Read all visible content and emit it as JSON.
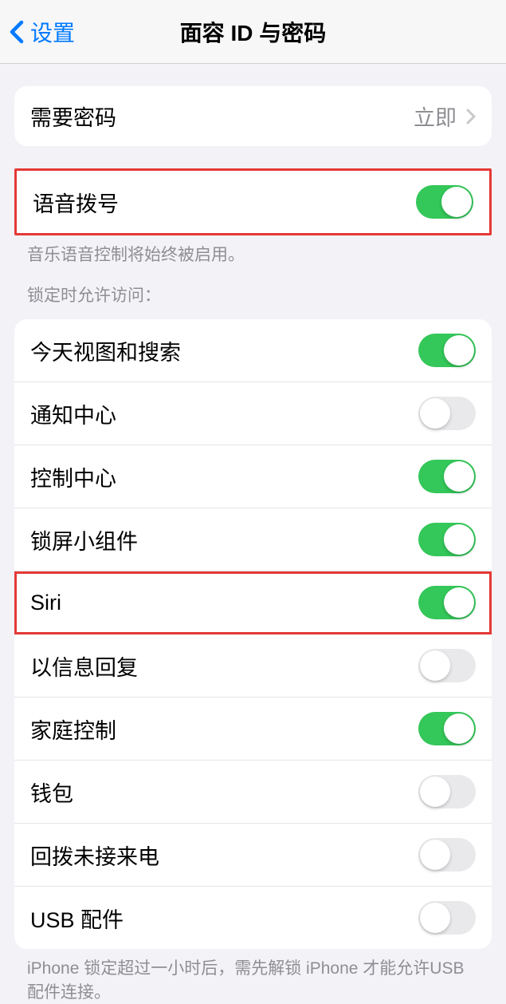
{
  "header": {
    "back_label": "设置",
    "title": "面容 ID 与密码"
  },
  "require_passcode": {
    "label": "需要密码",
    "value": "立即"
  },
  "voice_dial": {
    "label": "语音拨号",
    "enabled": true,
    "footer": "音乐语音控制将始终被启用。"
  },
  "lock_access": {
    "header": "锁定时允许访问：",
    "items": [
      {
        "label": "今天视图和搜索",
        "enabled": true,
        "highlighted": false
      },
      {
        "label": "通知中心",
        "enabled": false,
        "highlighted": false
      },
      {
        "label": "控制中心",
        "enabled": true,
        "highlighted": false
      },
      {
        "label": "锁屏小组件",
        "enabled": true,
        "highlighted": false
      },
      {
        "label": "Siri",
        "enabled": true,
        "highlighted": true
      },
      {
        "label": "以信息回复",
        "enabled": false,
        "highlighted": false
      },
      {
        "label": "家庭控制",
        "enabled": true,
        "highlighted": false
      },
      {
        "label": "钱包",
        "enabled": false,
        "highlighted": false
      },
      {
        "label": "回拨未接来电",
        "enabled": false,
        "highlighted": false
      },
      {
        "label": "USB 配件",
        "enabled": false,
        "highlighted": false
      }
    ],
    "footer": "iPhone 锁定超过一小时后，需先解锁 iPhone 才能允许USB 配件连接。"
  }
}
